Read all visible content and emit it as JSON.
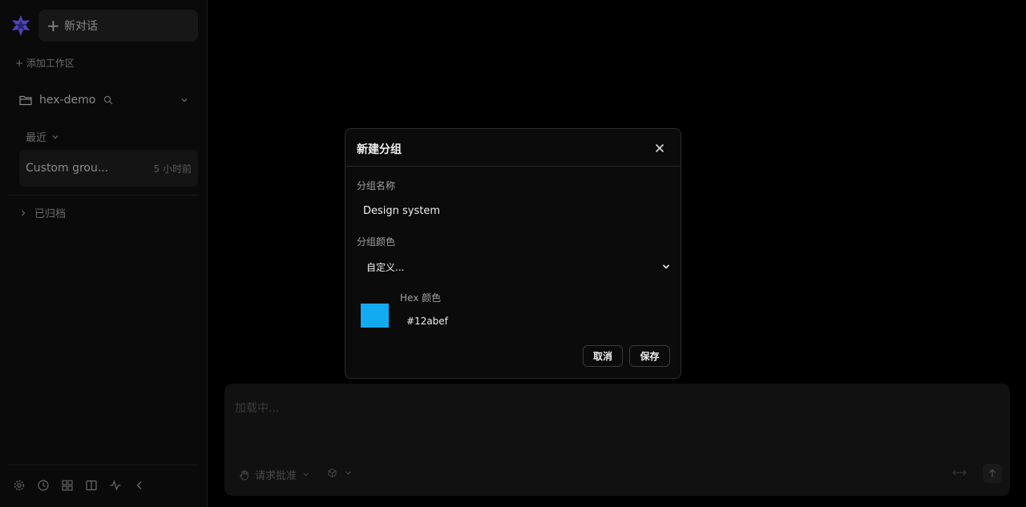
{
  "sidebar": {
    "new_chat_label": "新对话",
    "add_workspace_label": "+ 添加工作区",
    "workspace_name": "hex-demo",
    "recent_label": "最近",
    "conversations": [
      {
        "title": "Custom grou...",
        "time": "5 小时前"
      }
    ],
    "archived_label": "已归档",
    "footer_icons": [
      "gear-icon",
      "clock-icon",
      "grid-icon",
      "split-view-icon",
      "activity-icon",
      "collapse-icon"
    ]
  },
  "composer": {
    "placeholder": "加载中...",
    "approval_label": "请求批准"
  },
  "modal": {
    "title": "新建分组",
    "name_label": "分组名称",
    "name_value": "Design system",
    "color_label": "分组颜色",
    "color_selected": "自定义...",
    "hex_label": "Hex 颜色",
    "hex_value": "#12abef",
    "swatch_color": "#12abef",
    "cancel_label": "取消",
    "save_label": "保存"
  }
}
